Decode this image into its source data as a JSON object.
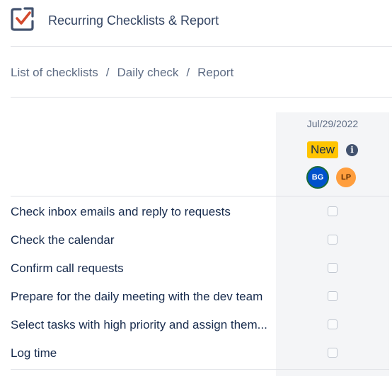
{
  "app": {
    "title": "Recurring Checklists & Report",
    "icon": "checklist-icon",
    "accent_color": "#d34a2e",
    "icon_color": "#42526e"
  },
  "breadcrumb": {
    "items": [
      "List of checklists",
      "Daily check",
      "Report"
    ],
    "separator": "/"
  },
  "report": {
    "date": "Jul/29/2022",
    "status": "New",
    "status_color": "#ffc400",
    "info_icon": "info-icon",
    "assignees": [
      {
        "initials": "BG",
        "color": "#0052cc"
      },
      {
        "initials": "LP",
        "color": "#ff9e3d"
      }
    ]
  },
  "tasks": [
    {
      "label": "Check inbox emails and reply to requests",
      "checked": false
    },
    {
      "label": "Check the calendar",
      "checked": false
    },
    {
      "label": "Confirm call requests",
      "checked": false
    },
    {
      "label": "Prepare for the daily meeting with the dev team",
      "checked": false
    },
    {
      "label": "Select tasks with high priority and assign them...",
      "checked": false
    },
    {
      "label": "Log time",
      "checked": false
    }
  ]
}
